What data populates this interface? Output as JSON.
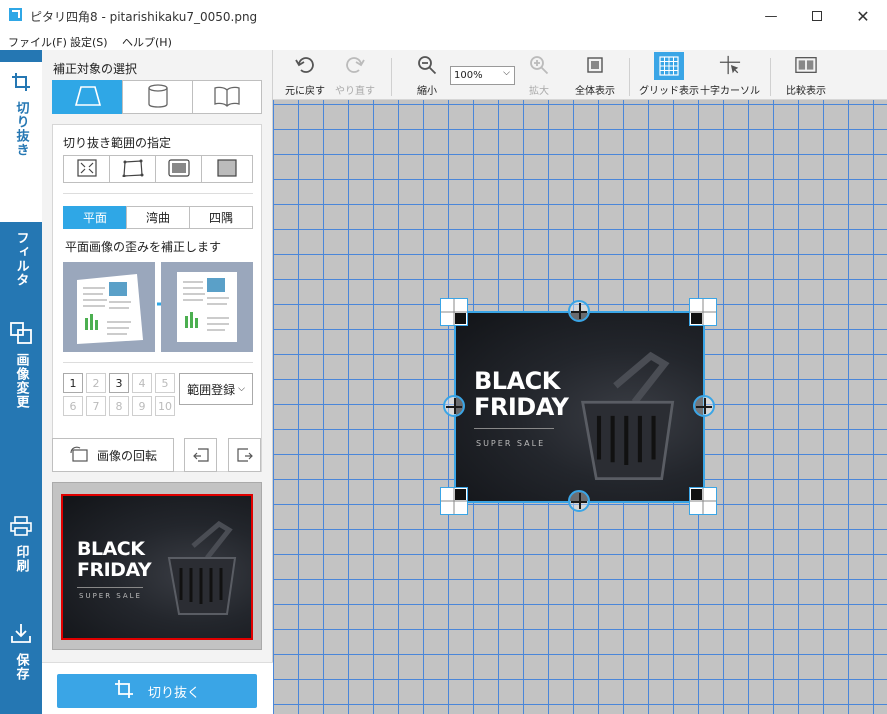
{
  "window": {
    "title": "ピタリ四角8 - pitarishikaku7_0050.png",
    "controls": [
      "minimize",
      "maximize",
      "close"
    ]
  },
  "menu": [
    "ファイル(F)",
    "設定(S)",
    "ヘルプ(H)"
  ],
  "sidebar": {
    "tabs": [
      {
        "label": "切り抜き",
        "icon": "crop-icon",
        "active": true
      },
      {
        "label": "フィルタ",
        "icon": "aperture-icon"
      },
      {
        "label": "画像変更",
        "icon": "resize-icon"
      },
      {
        "label": "印刷",
        "icon": "printer-icon"
      },
      {
        "label": "保存",
        "icon": "download-icon"
      }
    ]
  },
  "panel": {
    "target_title": "補正対象の選択",
    "target_buttons": [
      "flat-shape-icon",
      "cylinder-icon",
      "book-icon"
    ],
    "range_title": "切り抜き範囲の指定",
    "range_buttons": [
      "auto-detect-icon",
      "free-quad-icon",
      "frame-icon",
      "full-image-icon"
    ],
    "mode_tabs": [
      "平面",
      "湾曲",
      "四隅"
    ],
    "mode_description": "平面画像の歪みを補正します",
    "numbers": [
      "1",
      "2",
      "3",
      "4",
      "5",
      "6",
      "7",
      "8",
      "9",
      "10"
    ],
    "range_register": "範囲登録",
    "rotate_label": "画像の回転",
    "crop_button": "切り抜く"
  },
  "toolbar": {
    "undo": "元に戻す",
    "redo": "やり直す",
    "zoom_out": "縮小",
    "zoom_value": "100%",
    "zoom_in": "拡大",
    "fit": "全体表示",
    "grid": "グリッド表示",
    "cross": "十字カーソル",
    "compare": "比較表示"
  },
  "image": {
    "line1": "BLACK",
    "line2": "FRIDAY",
    "line3": "SUPER SALE"
  },
  "colors": {
    "accent": "#2577b3",
    "accent_light": "#3aa5e6",
    "grid": "#4a86d9",
    "canvas": "#c3c3c3"
  }
}
